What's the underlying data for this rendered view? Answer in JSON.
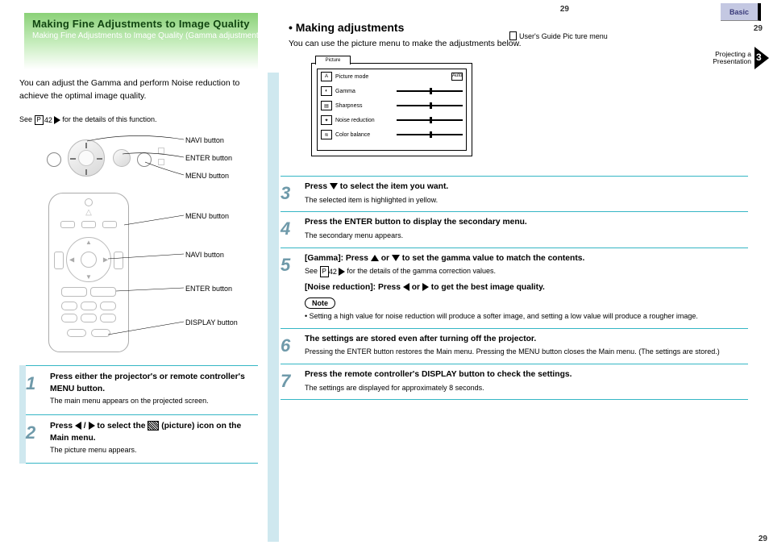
{
  "tab_label": "Basic",
  "page_number_mid": "29",
  "page_number_top": "29",
  "page_number_bottom": "29",
  "banner": {
    "title": "Making Fine Adjustments to Image Quality",
    "subtitle": "Making Fine Adjustments to Image Quality (Gamma adjustment and noise reduction)"
  },
  "left_intro": "You can adjust the Gamma and perform Noise reduction to achieve the optimal image quality.",
  "left_note_prefix": "See ",
  "left_note_page": "42",
  "left_note_suffix": " for the details of this function.",
  "panel_labels": {
    "navi": "NAVI button",
    "enter": "ENTER button",
    "menu": "MENU button"
  },
  "remote_labels": {
    "menu": "MENU button",
    "navi": "NAVI button",
    "enter": "ENTER button",
    "display": "DISPLAY button"
  },
  "left_steps": {
    "s1": {
      "heading": "Press either the projector's or remote controller's MENU button.",
      "desc": "The main menu appears on the projected screen."
    },
    "s2": {
      "heading_prefix": "Press ",
      "heading_mid": " to select the ",
      "heading_icon_label": "picture",
      "heading_suffix": " (picture) icon on the Main menu.",
      "desc": "The picture menu appears."
    }
  },
  "osd": {
    "tab": "Picture",
    "rows": [
      {
        "label": "Picture mode",
        "value": "Auto"
      },
      {
        "label": "Gamma",
        "slider": true
      },
      {
        "label": "Sharpness",
        "slider": true
      },
      {
        "label": "Noise reduction",
        "slider": true
      },
      {
        "label": "Color balance",
        "slider": true
      }
    ]
  },
  "right": {
    "title": "• Making adjustments",
    "subtitle": "You can use the picture menu to make the adjustments below.",
    "docref": "User's Guide Pic ture menu"
  },
  "chapter": {
    "label": "Projecting a\nPresentation",
    "num": "3"
  },
  "rsteps": {
    "s3": {
      "heading": "Press  to select the item you want.",
      "desc": "The selected item is highlighted in yellow."
    },
    "s4": {
      "heading": "Press the ENTER button to display the secondary menu.",
      "desc": "The secondary menu appears."
    },
    "s5": {
      "head1_prefix": "[Gamma]: Press ",
      "head1_mid": " or ",
      "head1_suffix": " to set the gamma value to match the contents.",
      "desc1_prefix": "See ",
      "desc1_page": "42",
      "desc1_suffix": " for the details of the gamma correction values.",
      "head2_prefix": "[Noise reduction]: Press ",
      "head2_mid": " or ",
      "head2_suffix": " to get the best image quality.",
      "note_label": "Note",
      "note_body": "• Setting a high value for noise reduction will produce a softer image, and setting a low value will produce a rougher image."
    },
    "s6": {
      "heading": "The settings are stored even after turning off the projector.",
      "desc": "Pressing the ENTER button restores the Main menu. Pressing the MENU button closes the Main menu. (The settings are stored.)"
    },
    "s7": {
      "heading": "Press the remote controller's DISPLAY button to check the settings.",
      "desc": "The settings are displayed for approximately 8 seconds."
    }
  }
}
